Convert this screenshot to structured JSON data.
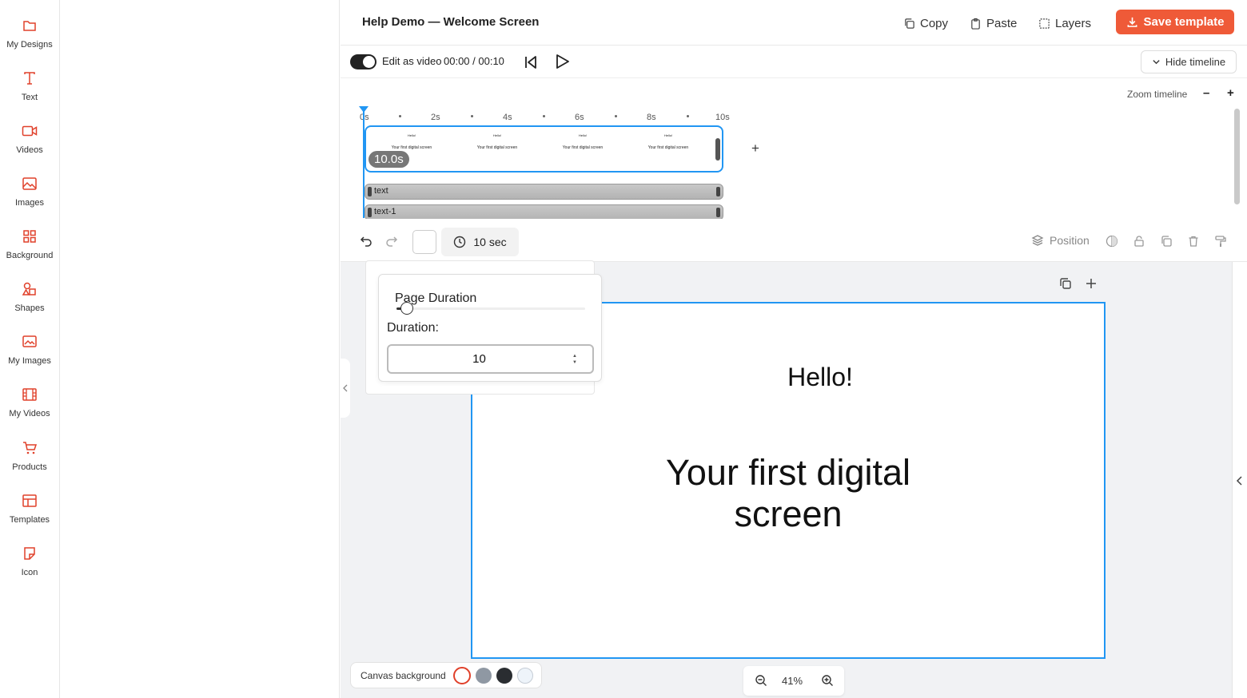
{
  "header": {
    "title": "Help Demo — Welcome Screen",
    "copy_label": "Copy",
    "paste_label": "Paste",
    "layers_label": "Layers",
    "save_label": "Save template"
  },
  "sidebar": {
    "items": [
      {
        "label": "My Designs",
        "icon": "folder-icon"
      },
      {
        "label": "Text",
        "icon": "text-icon"
      },
      {
        "label": "Videos",
        "icon": "video-icon"
      },
      {
        "label": "Images",
        "icon": "image-icon"
      },
      {
        "label": "Background",
        "icon": "grid-icon"
      },
      {
        "label": "Shapes",
        "icon": "shapes-icon"
      },
      {
        "label": "My Images",
        "icon": "my-images-icon"
      },
      {
        "label": "My Videos",
        "icon": "film-icon"
      },
      {
        "label": "Products",
        "icon": "cart-icon"
      },
      {
        "label": "Templates",
        "icon": "template-icon"
      },
      {
        "label": "Icon",
        "icon": "sticker-icon"
      }
    ]
  },
  "video_bar": {
    "edit_as_video_label": "Edit as video",
    "edit_as_video_on": true,
    "time_display": "00:00 / 00:10",
    "hide_timeline_label": "Hide timeline"
  },
  "timeline": {
    "zoom_label": "Zoom timeline",
    "ticks": [
      "0s",
      "2s",
      "4s",
      "6s",
      "8s",
      "10s"
    ],
    "page_duration_badge": "10.0s",
    "thumb_heading": "Hello!",
    "thumb_body": "Your first digital screen",
    "layers": [
      "text",
      "text-1"
    ]
  },
  "toolbar": {
    "duration_label": "10 sec",
    "position_label": "Position"
  },
  "popover": {
    "title": "Page Duration",
    "duration_label": "Duration:",
    "duration_value": "10",
    "slider_fraction": 0.05
  },
  "canvas": {
    "heading": "Hello!",
    "body": "Your first digital screen",
    "border_color": "#2196f3"
  },
  "canvas_background": {
    "label": "Canvas background",
    "swatches": [
      "#ffffff",
      "#8f98a3",
      "#2a2d31",
      "#eef4fa"
    ],
    "selected_ring": "#e0402a"
  },
  "zoom": {
    "value": "41%"
  },
  "colors": {
    "accent": "#ef5a38",
    "icon_red": "#e0402a",
    "timeline_blue": "#2196f3"
  }
}
